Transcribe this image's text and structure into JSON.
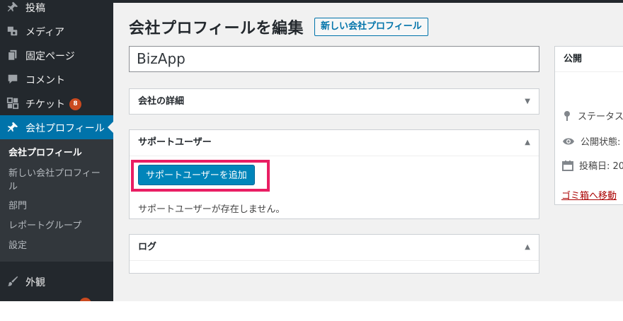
{
  "sidebar": {
    "menu": [
      {
        "label": "投稿",
        "icon": "pin-icon"
      },
      {
        "label": "メディア",
        "icon": "media-icon"
      },
      {
        "label": "固定ページ",
        "icon": "page-icon"
      },
      {
        "label": "コメント",
        "icon": "comment-icon"
      },
      {
        "label": "チケット",
        "icon": "grid-icon",
        "badge": "8"
      },
      {
        "label": "会社プロフィール",
        "icon": "pin-icon"
      },
      {
        "label": "外観",
        "icon": "brush-icon"
      }
    ],
    "submenu": [
      {
        "label": "会社プロフィール"
      },
      {
        "label": "新しい会社プロフィー"
      },
      {
        "label": "ル"
      },
      {
        "label": "部門"
      },
      {
        "label": "レポートグループ"
      },
      {
        "label": "設定"
      }
    ]
  },
  "header": {
    "title": "会社プロフィールを編集",
    "add_new_label": "新しい会社プロフィール"
  },
  "title_field": {
    "value": "BizApp"
  },
  "metaboxes": {
    "details": {
      "title": "会社の詳細",
      "toggle": "▼"
    },
    "support_users": {
      "title": "サポートユーザー",
      "toggle": "▲",
      "add_button_label": "サポートユーザーを追加",
      "empty_message": "サポートユーザーが存在しません。"
    },
    "log": {
      "title": "ログ",
      "toggle": "▲"
    }
  },
  "publish": {
    "title": "公開",
    "status_label": "ステータス",
    "visibility_label": "公開状態: 公",
    "date_label": "投稿日: 20",
    "trash_label": "ゴミ箱へ移動"
  },
  "colors": {
    "sidebar_bg": "#23282d",
    "accent": "#0073aa",
    "highlight": "#e91e63",
    "badge": "#ca4a1f",
    "trash": "#aa0000"
  }
}
